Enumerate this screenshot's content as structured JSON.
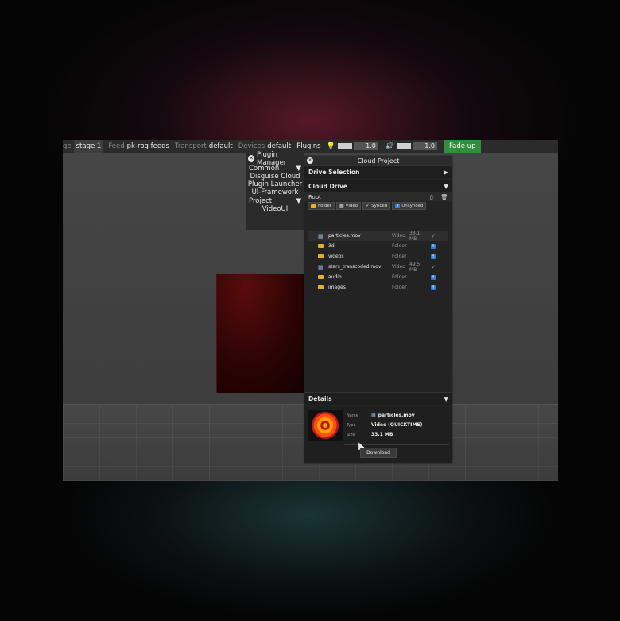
{
  "menubar": {
    "stage_label_partial": "ge",
    "stage_value": "stage 1",
    "feed_label": "Feed",
    "feed_value": "pk-rog feeds",
    "transport_label": "Transport",
    "transport_value": "default",
    "devices_label": "Devices",
    "devices_value": "default",
    "plugins_label": "Plugins",
    "brightness_value": "1.0",
    "volume_value": "1.0",
    "fade_button": "Fade up"
  },
  "plugin_manager": {
    "title": "Plugin Manager",
    "sections": [
      {
        "label": "Common",
        "items": [
          "Disguise Cloud",
          "Plugin Launcher",
          "UI-Framework"
        ]
      },
      {
        "label": "Project",
        "items": [
          "VideoUI"
        ]
      }
    ]
  },
  "cloud_project": {
    "title": "Cloud Project",
    "drive_selection": "Drive Selection",
    "cloud_drive": "Cloud Drive",
    "root_label": "Root",
    "filters": [
      {
        "icon": "folder-icon",
        "label": "Folder"
      },
      {
        "icon": "video-icon",
        "label": "Video"
      },
      {
        "icon": "check-icon",
        "label": "Synced"
      },
      {
        "icon": "upload-icon",
        "label": "Unsynced"
      }
    ],
    "files": [
      {
        "name": "particles.mov",
        "type": "Video",
        "size": "33.1 MB",
        "kind": "video",
        "status": "synced",
        "selected": true
      },
      {
        "name": "3d",
        "type": "Folder",
        "size": "",
        "kind": "folder",
        "status": "unsynced"
      },
      {
        "name": "videos",
        "type": "Folder",
        "size": "",
        "kind": "folder",
        "status": "unsynced"
      },
      {
        "name": "stars_transcoded.mov",
        "type": "Video",
        "size": "49.5 MB",
        "kind": "video",
        "status": "synced"
      },
      {
        "name": "audio",
        "type": "Folder",
        "size": "",
        "kind": "folder",
        "status": "unsynced"
      },
      {
        "name": "images",
        "type": "Folder",
        "size": "",
        "kind": "folder",
        "status": "unsynced"
      }
    ],
    "details": {
      "header": "Details",
      "name_label": "Name",
      "name_value": "particles.mov",
      "type_label": "Type",
      "type_value": "Video (QUICKTIME)",
      "size_label": "Size",
      "size_value": "33.1 MB",
      "download_button": "Download"
    }
  },
  "colors": {
    "fade_button": "#2f8f3a",
    "folder": "#e6b020",
    "unsynced": "#2f7fd6"
  }
}
